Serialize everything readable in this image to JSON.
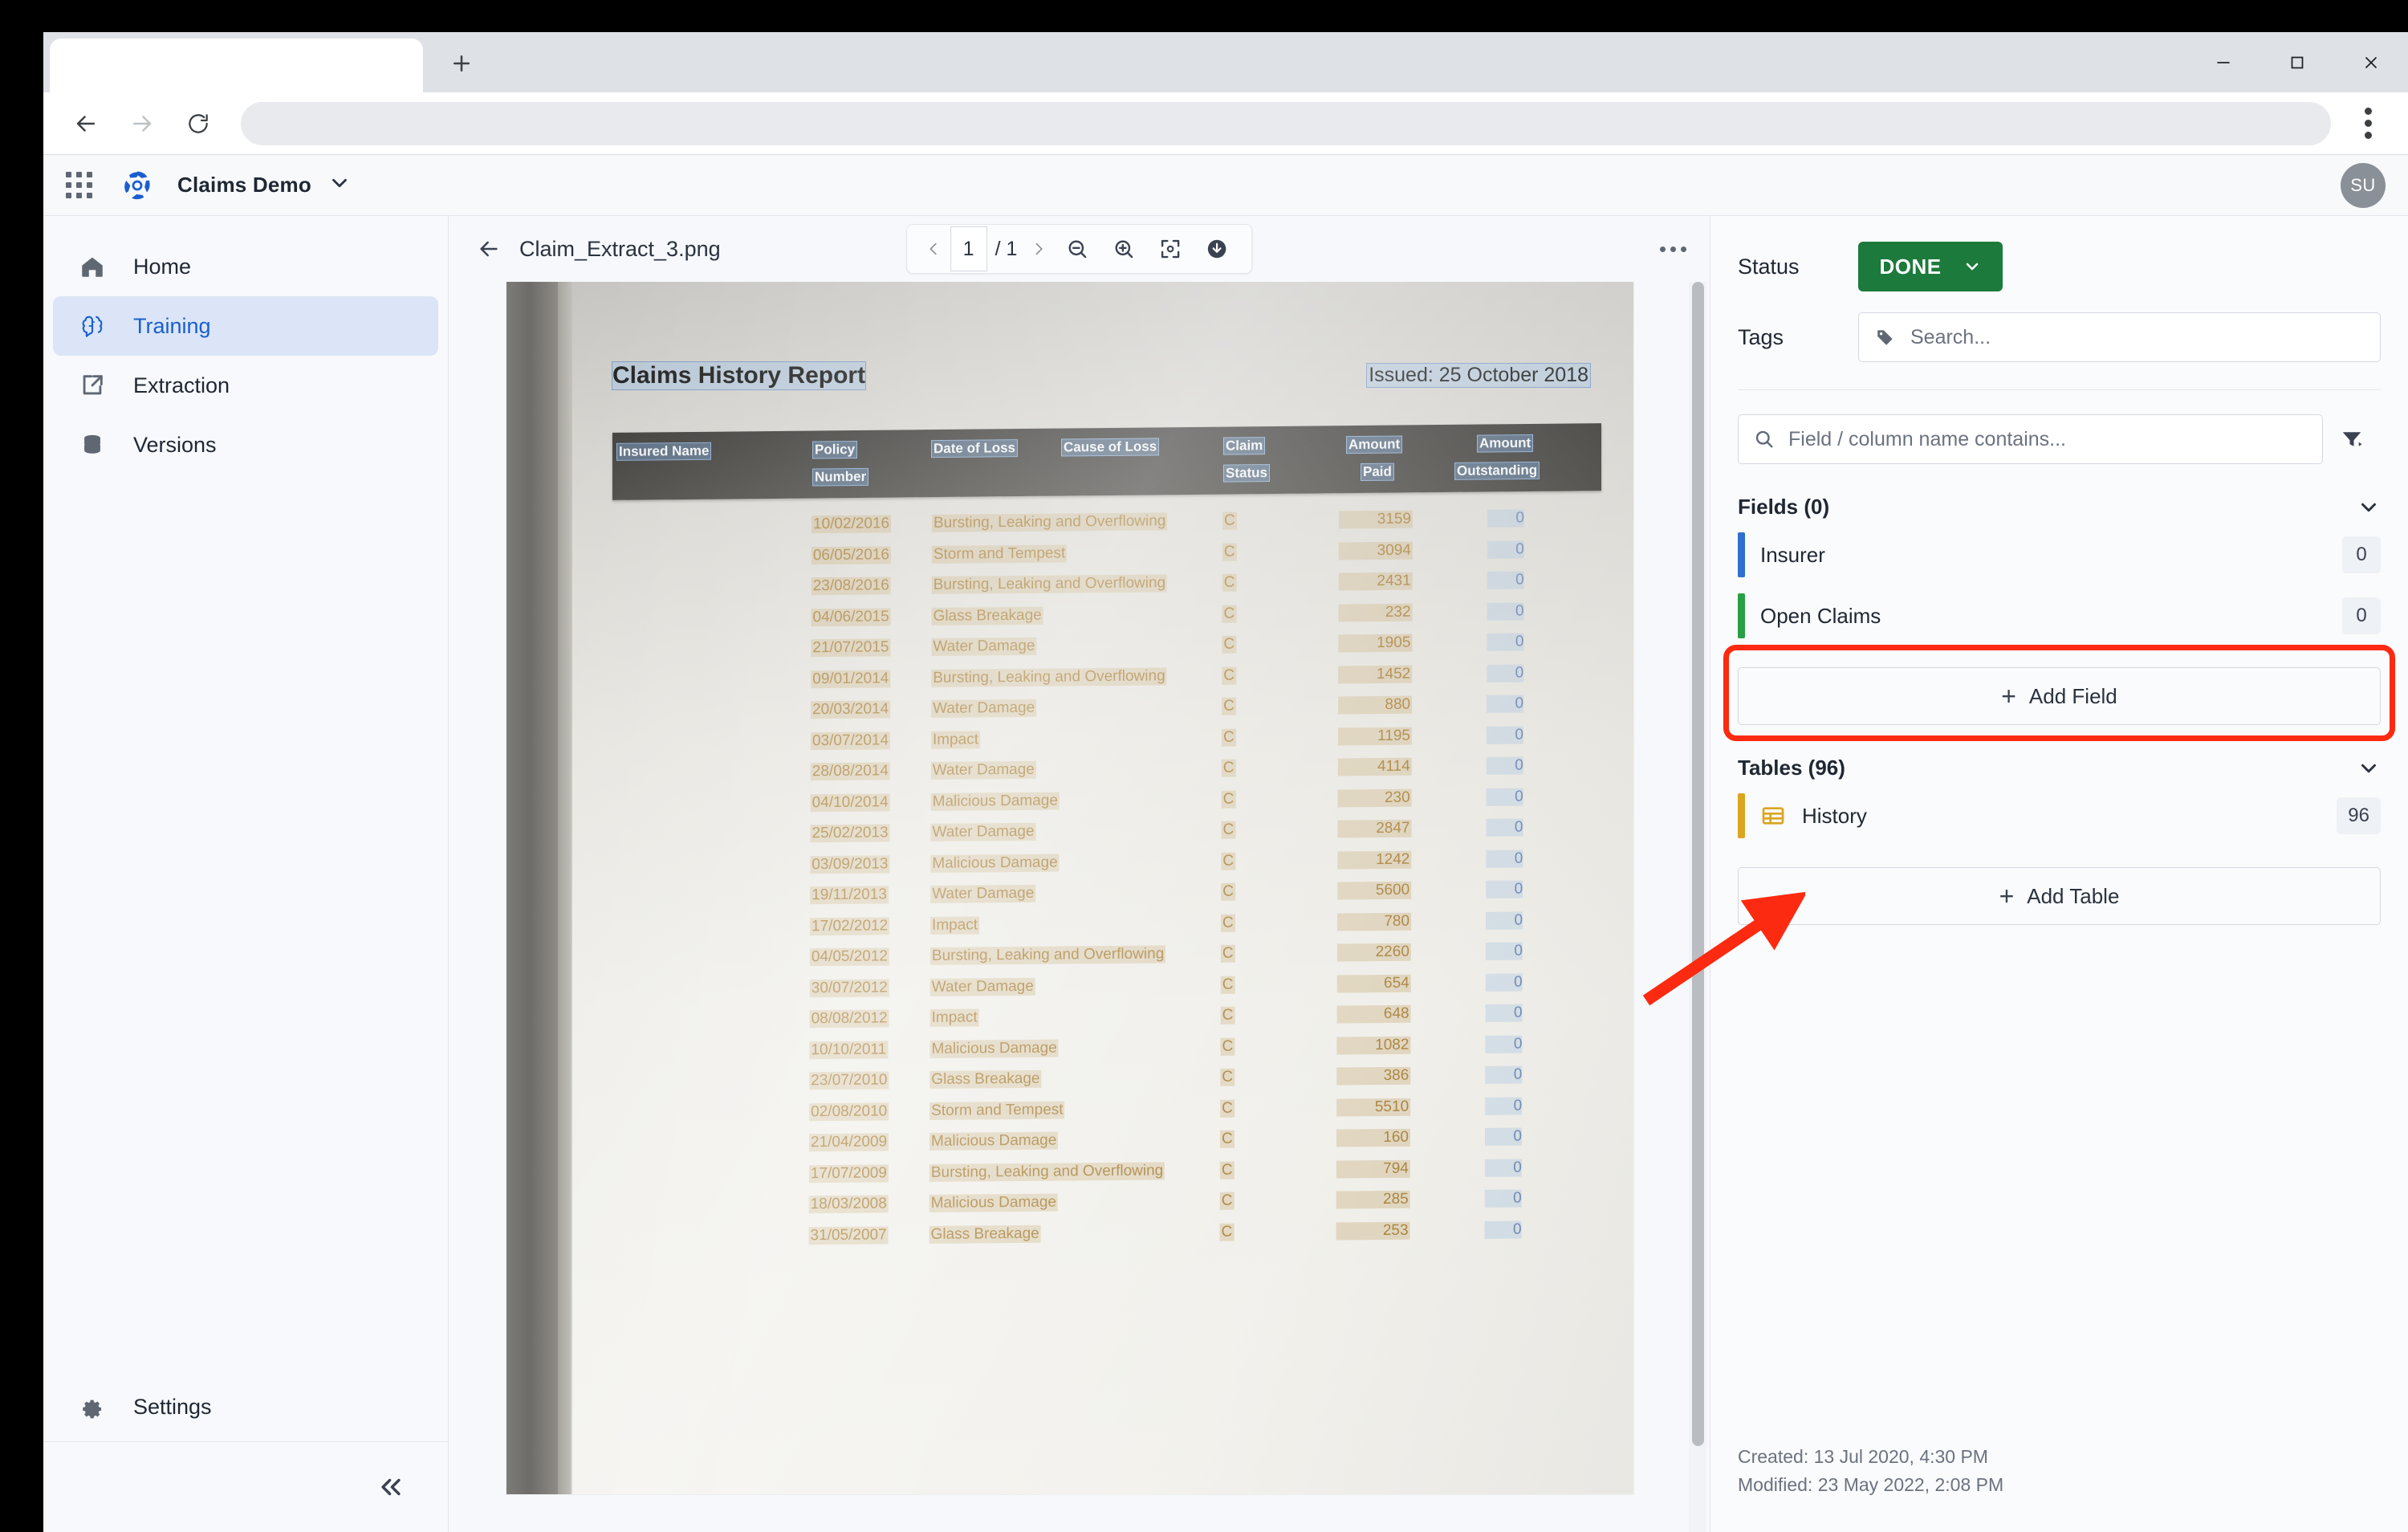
{
  "browser": {
    "tab_title": "",
    "url": "",
    "back_icon": "back-arrow-icon",
    "forward_icon": "forward-arrow-icon",
    "reload_icon": "reload-icon",
    "newtab_icon": "plus-icon",
    "minimize_icon": "minimize-icon",
    "maximize_icon": "maximize-icon",
    "close_icon": "close-icon",
    "menu_icon": "kebab-menu-icon"
  },
  "appbar": {
    "apps_icon": "grid-apps-icon",
    "logo_icon": "brand-logo-icon",
    "project_name": "Claims Demo",
    "project_caret_icon": "chevron-down-icon",
    "avatar_initials": "SU"
  },
  "sidebar": {
    "items": [
      {
        "label": "Home",
        "icon": "home-icon",
        "active": false
      },
      {
        "label": "Training",
        "icon": "brain-icon",
        "active": true
      },
      {
        "label": "Extraction",
        "icon": "export-icon",
        "active": false
      },
      {
        "label": "Versions",
        "icon": "database-icon",
        "active": false
      }
    ],
    "settings_label": "Settings",
    "settings_icon": "gear-icon",
    "collapse_icon": "double-chevron-left-icon"
  },
  "viewer": {
    "back_icon": "back-arrow-icon",
    "document_name": "Claim_Extract_3.png",
    "prev_page_icon": "chevron-left-icon",
    "current_page": "1",
    "page_total": "/ 1",
    "next_page_icon": "chevron-right-icon",
    "zoom_out_icon": "zoom-out-icon",
    "zoom_in_icon": "zoom-in-icon",
    "fit_icon": "fit-to-screen-icon",
    "download_icon": "download-icon",
    "more_icon": "more-options-icon"
  },
  "document": {
    "title": "Claims History Report",
    "issued_label": "Issued:",
    "issued_date": "25 October 2018",
    "headers": [
      "Insured Name",
      "Policy",
      "Number",
      "Date of Loss",
      "Cause of Loss",
      "Claim",
      "Status",
      "Amount",
      "Paid",
      "Amount",
      "Outstanding"
    ],
    "rows": [
      {
        "date": "10/02/2016",
        "cause": "Bursting, Leaking and Overflowing",
        "status": "C",
        "paid": "3159",
        "outstanding": "0"
      },
      {
        "date": "06/05/2016",
        "cause": "Storm and Tempest",
        "status": "C",
        "paid": "3094",
        "outstanding": "0"
      },
      {
        "date": "23/08/2016",
        "cause": "Bursting, Leaking and Overflowing",
        "status": "C",
        "paid": "2431",
        "outstanding": "0"
      },
      {
        "date": "04/06/2015",
        "cause": "Glass Breakage",
        "status": "C",
        "paid": "232",
        "outstanding": "0"
      },
      {
        "date": "21/07/2015",
        "cause": "Water Damage",
        "status": "C",
        "paid": "1905",
        "outstanding": "0"
      },
      {
        "date": "09/01/2014",
        "cause": "Bursting, Leaking and Overflowing",
        "status": "C",
        "paid": "1452",
        "outstanding": "0"
      },
      {
        "date": "20/03/2014",
        "cause": "Water Damage",
        "status": "C",
        "paid": "880",
        "outstanding": "0"
      },
      {
        "date": "03/07/2014",
        "cause": "Impact",
        "status": "C",
        "paid": "1195",
        "outstanding": "0"
      },
      {
        "date": "28/08/2014",
        "cause": "Water Damage",
        "status": "C",
        "paid": "4114",
        "outstanding": "0"
      },
      {
        "date": "04/10/2014",
        "cause": "Malicious Damage",
        "status": "C",
        "paid": "230",
        "outstanding": "0"
      },
      {
        "date": "25/02/2013",
        "cause": "Water Damage",
        "status": "C",
        "paid": "2847",
        "outstanding": "0"
      },
      {
        "date": "03/09/2013",
        "cause": "Malicious Damage",
        "status": "C",
        "paid": "1242",
        "outstanding": "0"
      },
      {
        "date": "19/11/2013",
        "cause": "Water Damage",
        "status": "C",
        "paid": "5600",
        "outstanding": "0"
      },
      {
        "date": "17/02/2012",
        "cause": "Impact",
        "status": "C",
        "paid": "780",
        "outstanding": "0"
      },
      {
        "date": "04/05/2012",
        "cause": "Bursting, Leaking and Overflowing",
        "status": "C",
        "paid": "2260",
        "outstanding": "0"
      },
      {
        "date": "30/07/2012",
        "cause": "Water Damage",
        "status": "C",
        "paid": "654",
        "outstanding": "0"
      },
      {
        "date": "08/08/2012",
        "cause": "Impact",
        "status": "C",
        "paid": "648",
        "outstanding": "0"
      },
      {
        "date": "10/10/2011",
        "cause": "Malicious Damage",
        "status": "C",
        "paid": "1082",
        "outstanding": "0"
      },
      {
        "date": "23/07/2010",
        "cause": "Glass Breakage",
        "status": "C",
        "paid": "386",
        "outstanding": "0"
      },
      {
        "date": "02/08/2010",
        "cause": "Storm and Tempest",
        "status": "C",
        "paid": "5510",
        "outstanding": "0"
      },
      {
        "date": "21/04/2009",
        "cause": "Malicious Damage",
        "status": "C",
        "paid": "160",
        "outstanding": "0"
      },
      {
        "date": "17/07/2009",
        "cause": "Bursting, Leaking and Overflowing",
        "status": "C",
        "paid": "794",
        "outstanding": "0"
      },
      {
        "date": "18/03/2008",
        "cause": "Malicious Damage",
        "status": "C",
        "paid": "285",
        "outstanding": "0"
      },
      {
        "date": "31/05/2007",
        "cause": "Glass Breakage",
        "status": "C",
        "paid": "253",
        "outstanding": "0"
      }
    ]
  },
  "panel": {
    "status_label": "Status",
    "status_value": "DONE",
    "status_color": "#1d7a3d",
    "status_caret_icon": "chevron-down-icon",
    "tags_label": "Tags",
    "tags_icon": "tag-icon",
    "tags_placeholder": "Search...",
    "search_icon": "search-icon",
    "search_placeholder": "Field / column name contains...",
    "filter_icon": "filter-icon",
    "fields_section": {
      "title": "Fields (0)",
      "collapse_icon": "chevron-down-icon",
      "items": [
        {
          "name": "Insurer",
          "count": "0",
          "color": "#2f6fd0"
        },
        {
          "name": "Open Claims",
          "count": "0",
          "color": "#27a043"
        }
      ],
      "add_label": "Add Field",
      "add_icon": "plus-icon",
      "add_highlighted": true,
      "highlight_color": "#fc2a10"
    },
    "tables_section": {
      "title": "Tables (96)",
      "collapse_icon": "chevron-down-icon",
      "items": [
        {
          "name": "History",
          "count": "96",
          "color": "#daa520",
          "icon": "table-icon"
        }
      ],
      "add_label": "Add Table",
      "add_icon": "plus-icon"
    },
    "created": "Created: 13 Jul 2020, 4:30 PM",
    "modified": "Modified: 23 May 2022, 2:08 PM"
  },
  "annotation": {
    "arrow_icon": "red-arrow-icon",
    "arrow_color": "#fc2a10"
  }
}
